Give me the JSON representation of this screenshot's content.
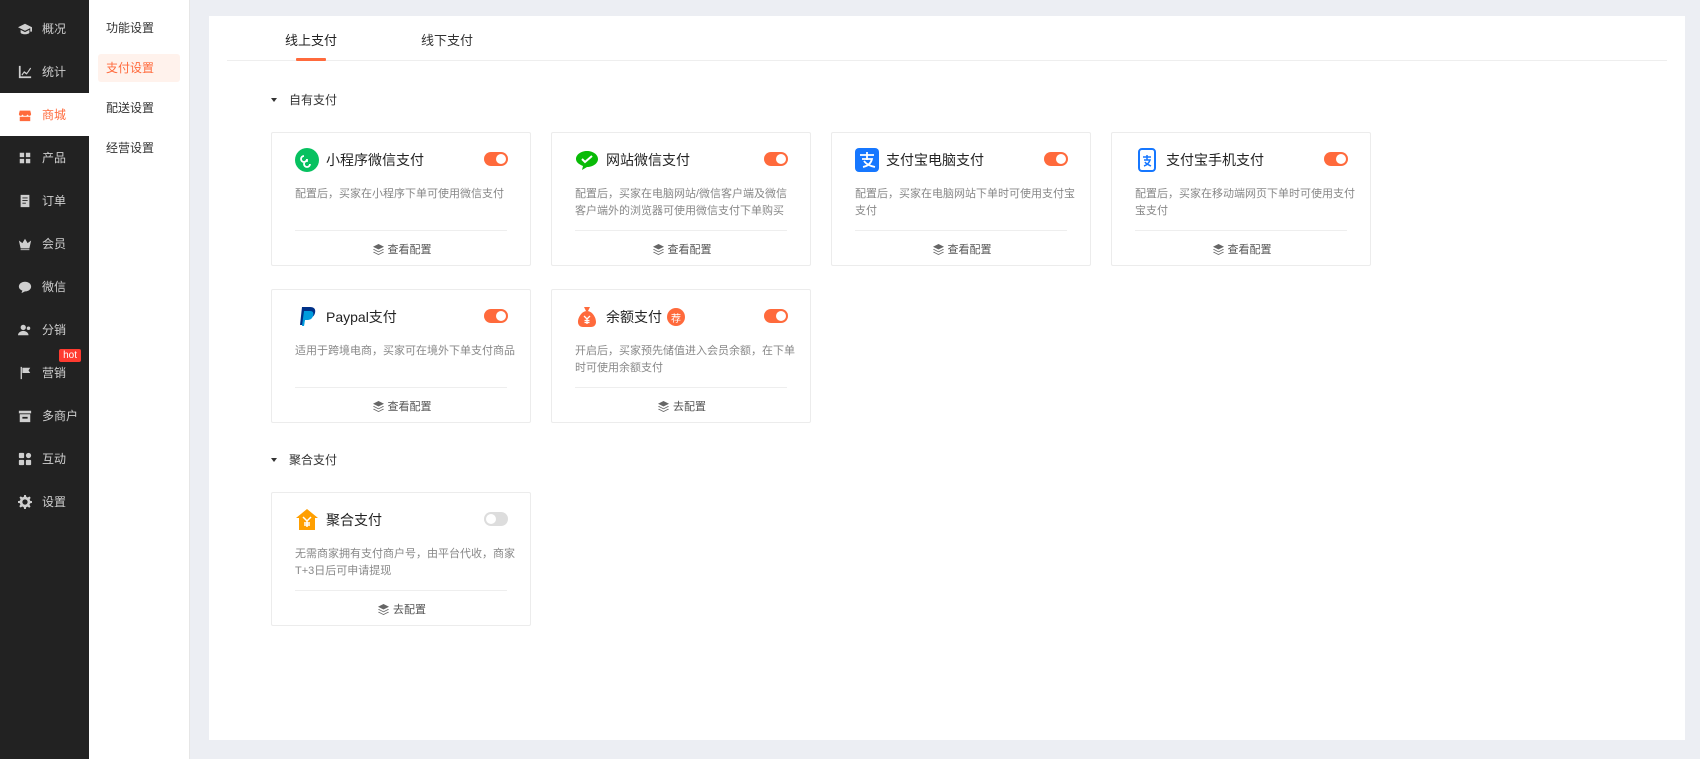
{
  "sidebar": {
    "items": [
      {
        "label": "概况",
        "icon": "graduation-cap-icon"
      },
      {
        "label": "统计",
        "icon": "chart-icon"
      },
      {
        "label": "商城",
        "icon": "store-icon"
      },
      {
        "label": "产品",
        "icon": "grid-icon"
      },
      {
        "label": "订单",
        "icon": "order-icon"
      },
      {
        "label": "会员",
        "icon": "crown-icon"
      },
      {
        "label": "微信",
        "icon": "chat-icon"
      },
      {
        "label": "分销",
        "icon": "users-icon"
      },
      {
        "label": "营销",
        "icon": "flag-icon",
        "badge": "hot"
      },
      {
        "label": "多商户",
        "icon": "shop-icon"
      },
      {
        "label": "互动",
        "icon": "apps-icon"
      },
      {
        "label": "设置",
        "icon": "gear-icon"
      }
    ],
    "active": "商城"
  },
  "submenu": {
    "items": [
      "功能设置",
      "支付设置",
      "配送设置",
      "经营设置"
    ],
    "active": "支付设置"
  },
  "tabs": {
    "online": "线上支付",
    "offline": "线下支付",
    "active": "线上支付"
  },
  "sections": {
    "own": {
      "title": "自有支付",
      "cards": [
        {
          "title": "小程序微信支付",
          "desc": "配置后，买家在小程序下单可使用微信支付",
          "action": "查看配置",
          "enabled": true,
          "icon": "mini-program-icon",
          "color": "#07c160"
        },
        {
          "title": "网站微信支付",
          "desc": "配置后，买家在电脑网站/微信客户端及微信客户端外的浏览器可使用微信支付下单购买",
          "action": "查看配置",
          "enabled": true,
          "icon": "wechat-pay-icon",
          "color": "#09bb07"
        },
        {
          "title": "支付宝电脑支付",
          "desc": "配置后，买家在电脑网站下单时可使用支付宝支付",
          "action": "查看配置",
          "enabled": true,
          "icon": "alipay-icon",
          "color": "#1677ff"
        },
        {
          "title": "支付宝手机支付",
          "desc": "配置后，买家在移动端网页下单时可使用支付宝支付",
          "action": "查看配置",
          "enabled": true,
          "icon": "alipay-mobile-icon",
          "color": "#1677ff"
        },
        {
          "title": "Paypal支付",
          "desc": "适用于跨境电商，买家可在境外下单支付商品",
          "action": "查看配置",
          "enabled": true,
          "icon": "paypal-icon",
          "color": "#003087"
        },
        {
          "title": "余额支付",
          "badge": "荐",
          "desc": "开启后，买家预先储值进入会员余额，在下单时可使用余额支付",
          "action": "去配置",
          "enabled": true,
          "icon": "money-bag-icon",
          "color": "#ff6a3c"
        }
      ]
    },
    "aggregate": {
      "title": "聚合支付",
      "cards": [
        {
          "title": "聚合支付",
          "desc": "无需商家拥有支付商户号，由平台代收，商家T+3日后可申请提现",
          "action": "去配置",
          "enabled": false,
          "icon": "yuan-house-icon",
          "color": "#ff9f00"
        }
      ]
    }
  },
  "colors": {
    "accent": "#ff6a3c",
    "sidebar_bg": "#222222"
  }
}
